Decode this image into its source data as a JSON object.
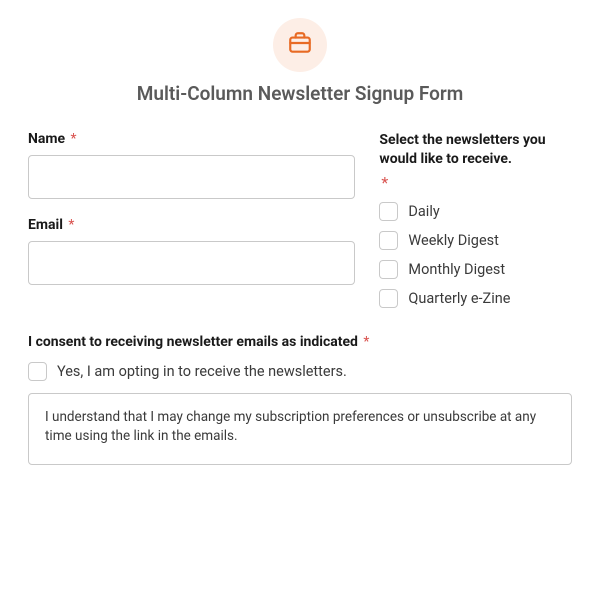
{
  "header": {
    "icon": "briefcase-icon",
    "title": "Multi-Column Newsletter Signup Form"
  },
  "fields": {
    "name": {
      "label": "Name",
      "required": true,
      "value": ""
    },
    "email": {
      "label": "Email",
      "required": true,
      "value": ""
    }
  },
  "newsletters": {
    "label": "Select the newsletters you would like to receive.",
    "required": true,
    "options": [
      "Daily",
      "Weekly Digest",
      "Monthly Digest",
      "Quarterly e-Zine"
    ]
  },
  "consent": {
    "label": "I consent to receiving newsletter emails as indicated",
    "required": true,
    "optin_text": "Yes, I am opting in to receive the newsletters.",
    "disclaimer": "I understand that I may change my subscription preferences or unsubscribe at any time using the link in the emails."
  },
  "required_marker": "*"
}
